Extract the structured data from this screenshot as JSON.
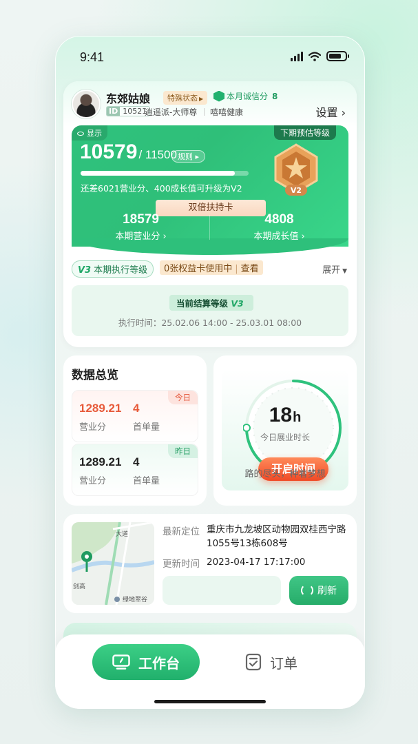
{
  "status_bar": {
    "time": "9:41"
  },
  "profile": {
    "name": "东郊姑娘",
    "special_tag": "特殊状态",
    "credit_label": "本月诚信分",
    "credit_value": "8",
    "id_label": "ID",
    "id_value": "10521",
    "subtitle_1": "逍遥派-大师尊",
    "subtitle_2": "嘻嘻健康",
    "settings_label": "设置"
  },
  "level": {
    "show_label": "显示",
    "next_level_label": "下期预估等级",
    "score": "10579",
    "score_total": "/ 11500",
    "rule_label": "规则",
    "progress_ratio": 0.92,
    "upgrade_tip": "还差6021营业分、400成长值可升级为V2",
    "medal_level": "V2",
    "double_card": "双倍扶持卡",
    "stats": [
      {
        "value": "18579",
        "label": "本期营业分"
      },
      {
        "value": "4808",
        "label": "本期成长值"
      }
    ]
  },
  "execution": {
    "level_tag": "本期执行等级",
    "level_badge": "V3",
    "benefit_text": "0张权益卡使用中",
    "benefit_link": "查看",
    "expand_label": "展开",
    "settle_title": "当前结算等级",
    "settle_badge": "V3",
    "settle_time": "执行时间：25.02.06 14:00 - 25.03.01 08:00"
  },
  "overview": {
    "title": "数据总览",
    "today": {
      "tag": "今日",
      "revenue": "1289.21",
      "orders": "4",
      "revenue_label": "营业分",
      "orders_label": "首单量"
    },
    "yesterday": {
      "tag": "昨日",
      "revenue": "1289.21",
      "orders": "4",
      "revenue_label": "营业分",
      "orders_label": "首单量"
    }
  },
  "work_time": {
    "hours": "18",
    "unit": "h",
    "label": "今日展业时长",
    "start_label": "开启时间",
    "motto": "路的尽头，种着梦想",
    "ring_ratio": 0.75
  },
  "location": {
    "latest_label": "最新定位",
    "latest_value": "重庆市九龙坡区动物园双桂西宁路1055号13栋608号",
    "update_label": "更新时间",
    "update_value": "2023-04-17 17:17:00",
    "refresh_label": "刷新",
    "map_labels": [
      "绿地翠谷",
      "剑高",
      "大道"
    ]
  },
  "tabs": [
    {
      "label": "工作台",
      "active": true
    },
    {
      "label": "订单",
      "active": false
    }
  ],
  "colors": {
    "primary_green": "#2fc27d",
    "accent_orange": "#f04a26",
    "today_red": "#e75a3a"
  }
}
